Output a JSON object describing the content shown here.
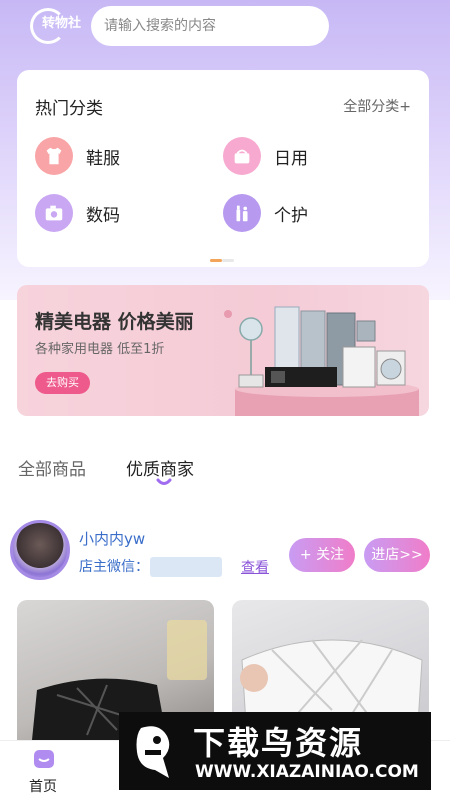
{
  "header": {
    "logo_text": "转物社",
    "search_placeholder": "请输入搜索的内容"
  },
  "categories": {
    "title": "热门分类",
    "all_label": "全部分类+",
    "items": [
      {
        "label": "鞋服",
        "icon": "clothing-icon",
        "color": "#f9a4a6"
      },
      {
        "label": "日用",
        "icon": "household-icon",
        "color": "#f7a9d0"
      },
      {
        "label": "数码",
        "icon": "camera-icon",
        "color": "#c9a7f3"
      },
      {
        "label": "个护",
        "icon": "personal-care-icon",
        "color": "#b79af0"
      }
    ]
  },
  "banner": {
    "title": "精美电器 价格美丽",
    "subtitle": "各种家用电器 低至1折",
    "button": "去购买"
  },
  "tabs": [
    {
      "label": "全部商品",
      "active": false
    },
    {
      "label": "优质商家",
      "active": true
    }
  ],
  "merchant": {
    "name": "小内内yw",
    "wechat_label": "店主微信：",
    "view_label": "查看",
    "follow_label": "+ 关注",
    "enter_label": "进店>>"
  },
  "bottom_nav": {
    "home_label": "首页"
  },
  "watermark": {
    "title": "下载鸟资源",
    "url": "WWW.XIAZAINIAO.COM"
  },
  "colors": {
    "accent": "#a78bfa",
    "pink": "#ee5a8b",
    "link": "#3a6ec9"
  }
}
